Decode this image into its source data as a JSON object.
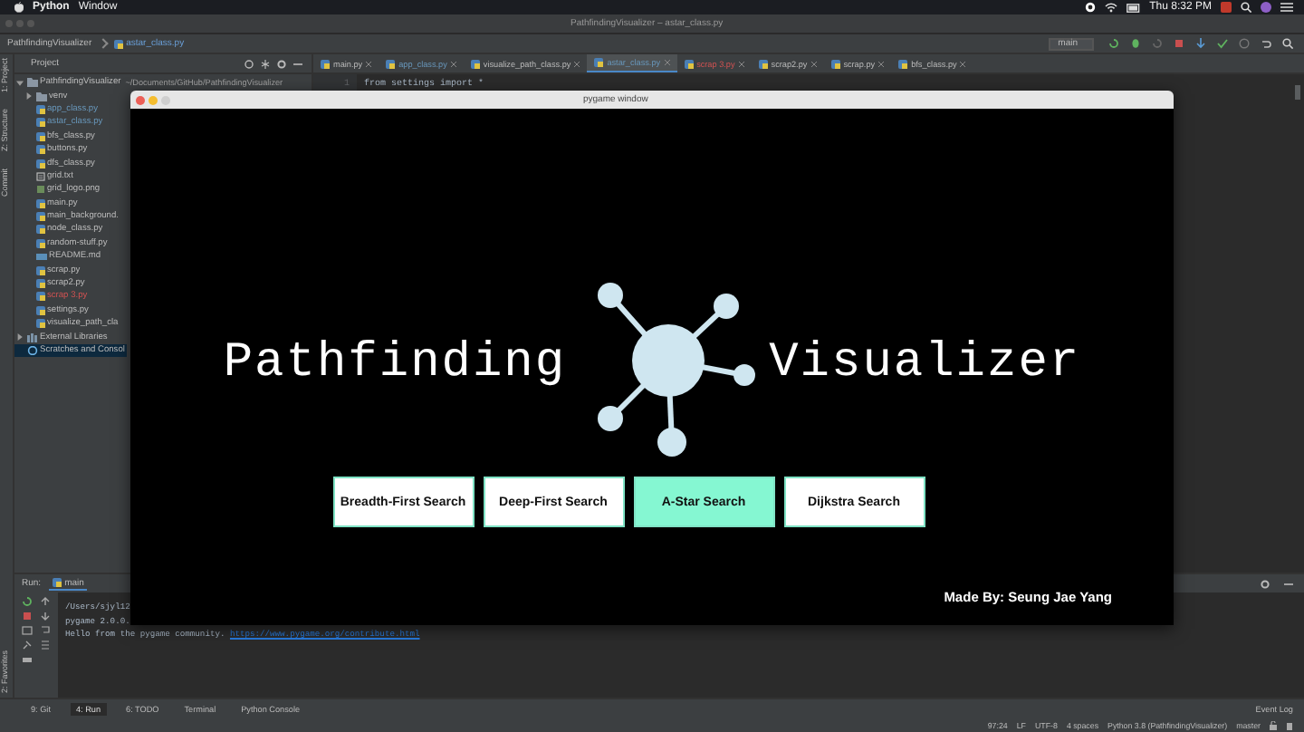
{
  "menubar": {
    "app": "Python",
    "menus": [
      "Window"
    ],
    "clock": "Thu 8:32 PM"
  },
  "window": {
    "title": "PathfindingVisualizer – astar_class.py"
  },
  "breadcrumb": [
    "PathfindingVisualizer",
    "astar_class.py"
  ],
  "run_config": {
    "label": "main"
  },
  "side_tabs": [
    "1: Project",
    "Z: Structure",
    "Commit"
  ],
  "project_panel": {
    "title": "Project",
    "tree": [
      {
        "label": "PathfindingVisualizer",
        "path": "~/Documents/GitHub/PathfindingVisualizer",
        "kind": "folder",
        "modified": false,
        "error": false,
        "expanded": true,
        "selected": false,
        "children": [
          {
            "label": "venv",
            "kind": "folder",
            "modified": false,
            "error": false,
            "expanded": false,
            "selected": false
          },
          {
            "label": "app_class.py",
            "kind": "python",
            "modified": true,
            "error": false,
            "selected": false
          },
          {
            "label": "astar_class.py",
            "kind": "python",
            "modified": true,
            "error": false,
            "selected": false
          },
          {
            "label": "bfs_class.py",
            "kind": "python",
            "modified": false,
            "error": false,
            "selected": false
          },
          {
            "label": "buttons.py",
            "kind": "python",
            "modified": false,
            "error": false,
            "selected": false
          },
          {
            "label": "dfs_class.py",
            "kind": "python",
            "modified": false,
            "error": false,
            "selected": false
          },
          {
            "label": "grid.txt",
            "kind": "text",
            "modified": false,
            "error": false,
            "selected": false
          },
          {
            "label": "grid_logo.png",
            "kind": "image",
            "modified": false,
            "error": false,
            "selected": false
          },
          {
            "label": "main.py",
            "kind": "python",
            "modified": false,
            "error": false,
            "selected": false
          },
          {
            "label": "main_background.",
            "kind": "python",
            "modified": false,
            "error": false,
            "selected": false
          },
          {
            "label": "node_class.py",
            "kind": "python",
            "modified": false,
            "error": false,
            "selected": false
          },
          {
            "label": "random-stuff.py",
            "kind": "python",
            "modified": false,
            "error": false,
            "selected": false
          },
          {
            "label": "README.md",
            "kind": "markdown",
            "modified": false,
            "error": false,
            "selected": false
          },
          {
            "label": "scrap.py",
            "kind": "python",
            "modified": false,
            "error": false,
            "selected": false
          },
          {
            "label": "scrap2.py",
            "kind": "python",
            "modified": false,
            "error": false,
            "selected": false
          },
          {
            "label": "scrap 3.py",
            "kind": "python",
            "modified": false,
            "error": true,
            "selected": false
          },
          {
            "label": "settings.py",
            "kind": "python",
            "modified": false,
            "error": false,
            "selected": false
          },
          {
            "label": "visualize_path_cla",
            "kind": "python",
            "modified": false,
            "error": false,
            "selected": false
          }
        ]
      },
      {
        "label": "External Libraries",
        "kind": "library",
        "modified": false,
        "error": false,
        "expanded": false,
        "selected": false
      },
      {
        "label": "Scratches and Consol",
        "kind": "scratch",
        "modified": false,
        "error": false,
        "selected": true
      }
    ]
  },
  "editor": {
    "tabs": [
      {
        "label": "main.py",
        "modified": false,
        "error": false,
        "selected": false
      },
      {
        "label": "app_class.py",
        "modified": true,
        "error": false,
        "selected": false
      },
      {
        "label": "visualize_path_class.py",
        "modified": false,
        "error": false,
        "selected": false
      },
      {
        "label": "astar_class.py",
        "modified": true,
        "error": false,
        "selected": true
      },
      {
        "label": "scrap 3.py",
        "modified": false,
        "error": true,
        "selected": false
      },
      {
        "label": "scrap2.py",
        "modified": false,
        "error": false,
        "selected": false
      },
      {
        "label": "scrap.py",
        "modified": false,
        "error": false,
        "selected": false
      },
      {
        "label": "bfs_class.py",
        "modified": false,
        "error": false,
        "selected": false
      }
    ],
    "lines": [
      {
        "number": "1",
        "code": "from settings import *"
      }
    ]
  },
  "pygame_window": {
    "title": "pygame window",
    "heading_left": "Pathfinding",
    "heading_right": "Visualizer",
    "buttons": [
      {
        "label": "Breadth-First Search",
        "selected": false
      },
      {
        "label": "Deep-First Search",
        "selected": false
      },
      {
        "label": "A-Star Search",
        "selected": true
      },
      {
        "label": "Dijkstra Search",
        "selected": false
      }
    ],
    "credit": "Made By: Seung Jae Yang"
  },
  "run_panel": {
    "label": "Run:",
    "tab": "main",
    "lines": [
      {
        "text": "/Users/sjyl12"
      },
      {
        "text": "pygame 2.0.0."
      },
      {
        "text": "Hello from the pygame community. ",
        "link": "https://www.pygame.org/contribute.html"
      }
    ]
  },
  "favorites_tab": "2: Favorites",
  "tool_tabs": [
    {
      "label": "9: Git",
      "selected": false
    },
    {
      "label": "4: Run",
      "selected": true
    },
    {
      "label": "6: TODO",
      "selected": false
    },
    {
      "label": "Terminal",
      "selected": false
    },
    {
      "label": "Python Console",
      "selected": false
    }
  ],
  "event_log": "Event Log",
  "status_bar": [
    "97:24",
    "LF",
    "UTF-8",
    "4 spaces",
    "Python 3.8 (PathfindingVisualizer)",
    "master"
  ]
}
